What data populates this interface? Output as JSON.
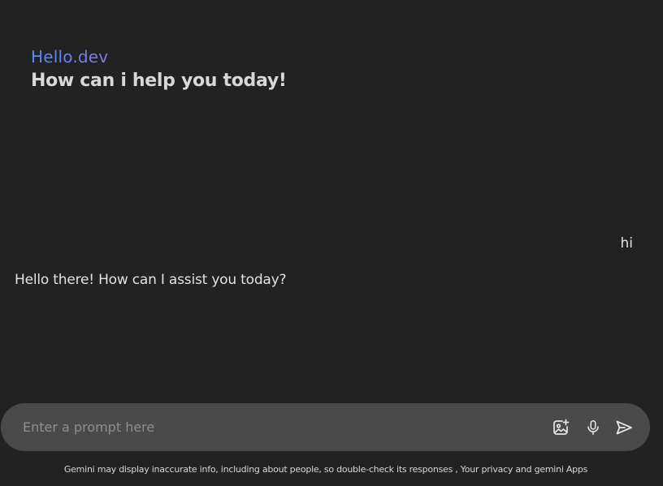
{
  "greeting": {
    "brand": "Hello.dev",
    "subtitle": "How can i help you today!"
  },
  "chat": {
    "messages": [
      {
        "role": "user",
        "text": "hi"
      },
      {
        "role": "assistant",
        "text": "Hello there! How can I assist you today?"
      }
    ]
  },
  "prompt": {
    "placeholder": "Enter a prompt here",
    "value": "",
    "icons": {
      "image": "add-image-icon",
      "mic": "microphone-icon",
      "send": "send-icon"
    }
  },
  "disclaimer": "Gemini may display inaccurate info, including about people, so double-check its responses , Your privacy and gemini Apps",
  "colors": {
    "background": "#222222",
    "prompt_bar": "#4a4a4a",
    "brand_gradient_start": "#4f8cff",
    "brand_gradient_end": "#e0455a",
    "text": "#e2e2e2"
  }
}
